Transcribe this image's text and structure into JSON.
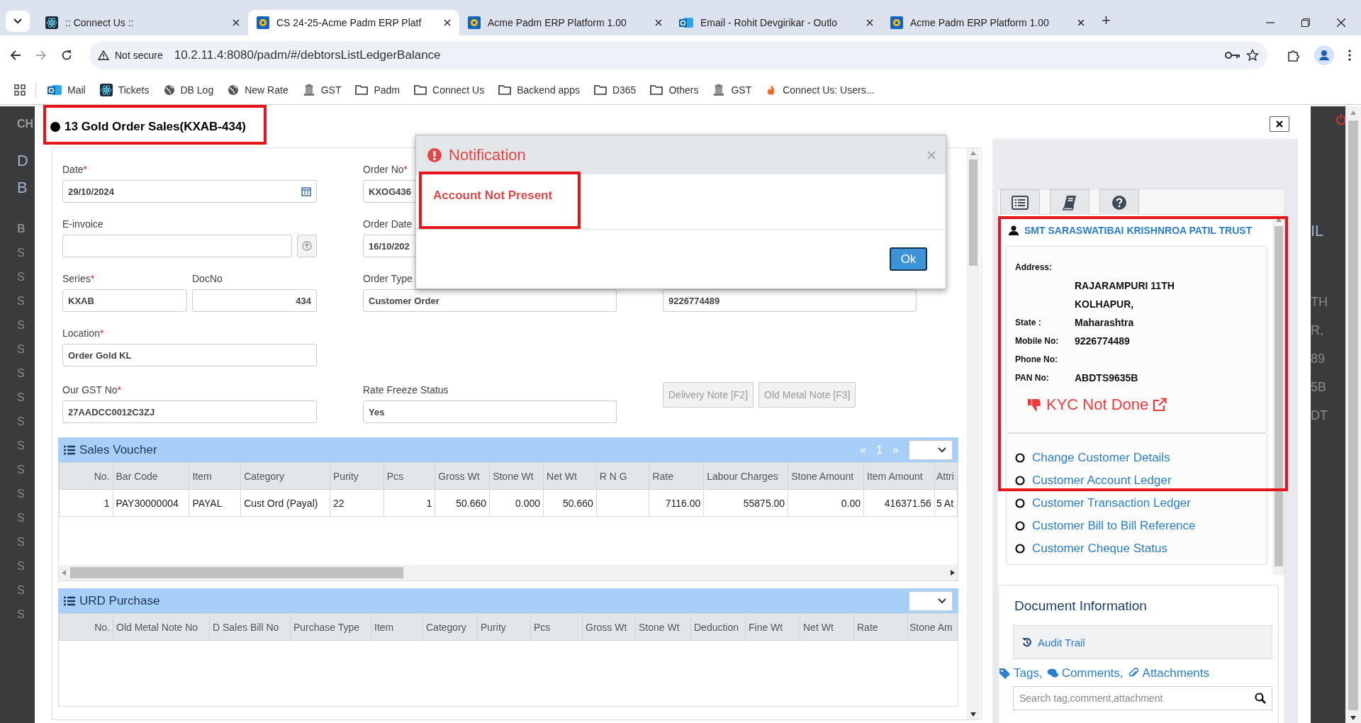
{
  "browser": {
    "tabs": [
      {
        "title": ":: Connect Us ::",
        "kind": "atom",
        "selected": false
      },
      {
        "title": "CS 24-25-Acme Padm ERP Platf",
        "kind": "erp",
        "selected": true
      },
      {
        "title": "Acme Padm ERP Platform 1.00",
        "kind": "erp",
        "selected": false
      },
      {
        "title": "Email - Rohit Devgirikar - Outlo",
        "kind": "mail",
        "selected": false
      },
      {
        "title": "Acme Padm ERP Platform 1.00",
        "kind": "erp",
        "selected": false
      }
    ],
    "new_tab": "+",
    "address": {
      "security": "Not secure",
      "url": "10.2.11.4:8080/padm/#/debtorsListLedgerBalance"
    },
    "bookmarks": [
      {
        "label": "Mail",
        "kind": "mail"
      },
      {
        "label": "Tickets",
        "kind": "atom"
      },
      {
        "label": "DB Log",
        "kind": "globe"
      },
      {
        "label": "New Rate",
        "kind": "globe"
      },
      {
        "label": "GST",
        "kind": "emblem"
      },
      {
        "label": "Padm",
        "kind": "folder"
      },
      {
        "label": "Connect Us",
        "kind": "folder"
      },
      {
        "label": "Backend apps",
        "kind": "folder"
      },
      {
        "label": "D365",
        "kind": "folder"
      },
      {
        "label": "Others",
        "kind": "folder"
      },
      {
        "label": "GST",
        "kind": "emblem"
      },
      {
        "label": "Connect Us: Users...",
        "kind": "flame"
      }
    ]
  },
  "background": {
    "left": [
      {
        "text": "CH",
        "kind": "heading"
      },
      {
        "text": "D",
        "kind": "title"
      },
      {
        "text": "B",
        "kind": "title"
      },
      {
        "text": "B",
        "kind": "header"
      },
      {
        "text": "S",
        "kind": "row"
      },
      {
        "text": "S",
        "kind": "row"
      },
      {
        "text": "S",
        "kind": "row"
      },
      {
        "text": "S",
        "kind": "row"
      },
      {
        "text": "S",
        "kind": "row"
      },
      {
        "text": "S",
        "kind": "row"
      },
      {
        "text": "S",
        "kind": "row"
      },
      {
        "text": "S",
        "kind": "row"
      },
      {
        "text": "S",
        "kind": "row"
      },
      {
        "text": "S",
        "kind": "row"
      },
      {
        "text": "S",
        "kind": "row"
      },
      {
        "text": "S",
        "kind": "row"
      },
      {
        "text": "S",
        "kind": "row"
      },
      {
        "text": "S",
        "kind": "row"
      },
      {
        "text": "S",
        "kind": "row"
      },
      {
        "text": "S",
        "kind": "row"
      }
    ],
    "right": [
      {
        "text": "IL",
        "kind": "title"
      },
      {
        "text": "TH",
        "kind": "row"
      },
      {
        "text": "R,",
        "kind": "row"
      },
      {
        "text": "89",
        "kind": "row"
      },
      {
        "text": "5B",
        "kind": "row"
      },
      {
        "text": "DT",
        "kind": "row"
      }
    ]
  },
  "modal": {
    "title": "13 Gold Order Sales(KXAB-434)",
    "form_rows": [
      [
        {
          "fields": [
            {
              "label": "Date",
              "required_mark": "*",
              "value": "29/10/2024",
              "kind": "date"
            }
          ]
        },
        {
          "fields": [
            {
              "label": "Order No",
              "required_mark": "*",
              "value": "KXOG436",
              "kind": "text"
            }
          ]
        },
        {}
      ],
      [
        {
          "fields": [
            {
              "label": "E-invoice",
              "kind": "upload"
            }
          ]
        },
        {
          "fields": [
            {
              "label": "Order Date",
              "value": "16/10/202",
              "kind": "text"
            }
          ]
        },
        {}
      ],
      [
        {
          "fields": [
            {
              "label": "Series",
              "required_mark": "*",
              "value": "KXAB",
              "kind": "text"
            },
            {
              "label": "DocNo",
              "value": "434",
              "kind": "number"
            }
          ]
        },
        {
          "fields": [
            {
              "label": "Order Type",
              "value": "Customer Order",
              "kind": "text"
            }
          ]
        },
        {
          "fields": [
            {
              "value": "9226774489",
              "kind": "text"
            }
          ]
        }
      ],
      [
        {
          "fields": [
            {
              "label": "Location",
              "required_mark": "*",
              "value": "Order Gold KL",
              "kind": "text"
            }
          ]
        },
        {},
        {}
      ],
      [
        {
          "fields": [
            {
              "label": "Our GST No",
              "required_mark": "*",
              "value": "27AADCC0012C3ZJ",
              "kind": "text"
            }
          ]
        },
        {
          "fields": [
            {
              "label": "Rate Freeze Status",
              "value": "Yes",
              "kind": "text"
            }
          ]
        },
        {
          "buttons": [
            {
              "label": "Delivery Note [F2]",
              "disabled": true
            },
            {
              "label": "Old Metal Note [F3]",
              "disabled": true
            }
          ]
        }
      ]
    ],
    "sales_voucher": {
      "title": "Sales Voucher",
      "pager": {
        "prev": "«",
        "page": "1",
        "next": "»"
      },
      "columns": [
        "No.",
        "Bar Code",
        "Item",
        "Category",
        "Purity",
        "Pcs",
        "Gross Wt",
        "Stone Wt",
        "Net Wt",
        "R N G",
        "Rate",
        "Labour Charges",
        "Stone Amount",
        "Item Amount",
        "Attri"
      ],
      "rows": [
        [
          "1",
          "PAY30000004",
          "PAYAL",
          "Cust Ord (Payal)",
          "22",
          "1",
          "50.660",
          "0.000",
          "50.660",
          "",
          "7116.00",
          "55875.00",
          "0.00",
          "416371.56",
          "5 At"
        ]
      ]
    },
    "urd_purchase": {
      "title": "URD Purchase",
      "columns": [
        "No.",
        "Old Metal Note No",
        "D Sales Bill No",
        "Purchase Type",
        "Item",
        "Category",
        "Purity",
        "Pcs",
        "Gross Wt",
        "Stone Wt",
        "Deduction",
        "Fine Wt",
        "Net Wt",
        "Rate",
        "Stone Am"
      ]
    },
    "side_tabs": [
      {
        "kind": "list"
      },
      {
        "kind": "book"
      },
      {
        "kind": "help"
      }
    ],
    "customer": {
      "name": "SMT SARASWATIBAI KRISHNROA PATIL TRUST",
      "details": [
        {
          "label": "Address:"
        },
        {
          "value": "RAJARAMPURI 11TH"
        },
        {
          "value": "KOLHAPUR,"
        },
        {
          "label": "State :",
          "value": "Maharashtra"
        },
        {
          "label": "Mobile No:",
          "value": "9226774489"
        },
        {
          "label": "Phone No:"
        },
        {
          "label": "PAN No:",
          "value": "ABDTS9635B"
        }
      ],
      "kyc": "KYC Not Done",
      "links": [
        "Change Customer Details",
        "Customer Account Ledger",
        "Customer Transaction Ledger",
        "Customer Bill to Bill Reference",
        "Customer Cheque Status"
      ]
    },
    "document_info": {
      "title": "Document Information",
      "audit": "Audit Trail",
      "tags": [
        "Tags,",
        "Comments,",
        "Attachments"
      ],
      "search": {
        "placeholder": "Search tag,comment,attachment"
      }
    }
  },
  "notification": {
    "title": "Notification",
    "message": "Account Not Present",
    "button": "Ok"
  }
}
